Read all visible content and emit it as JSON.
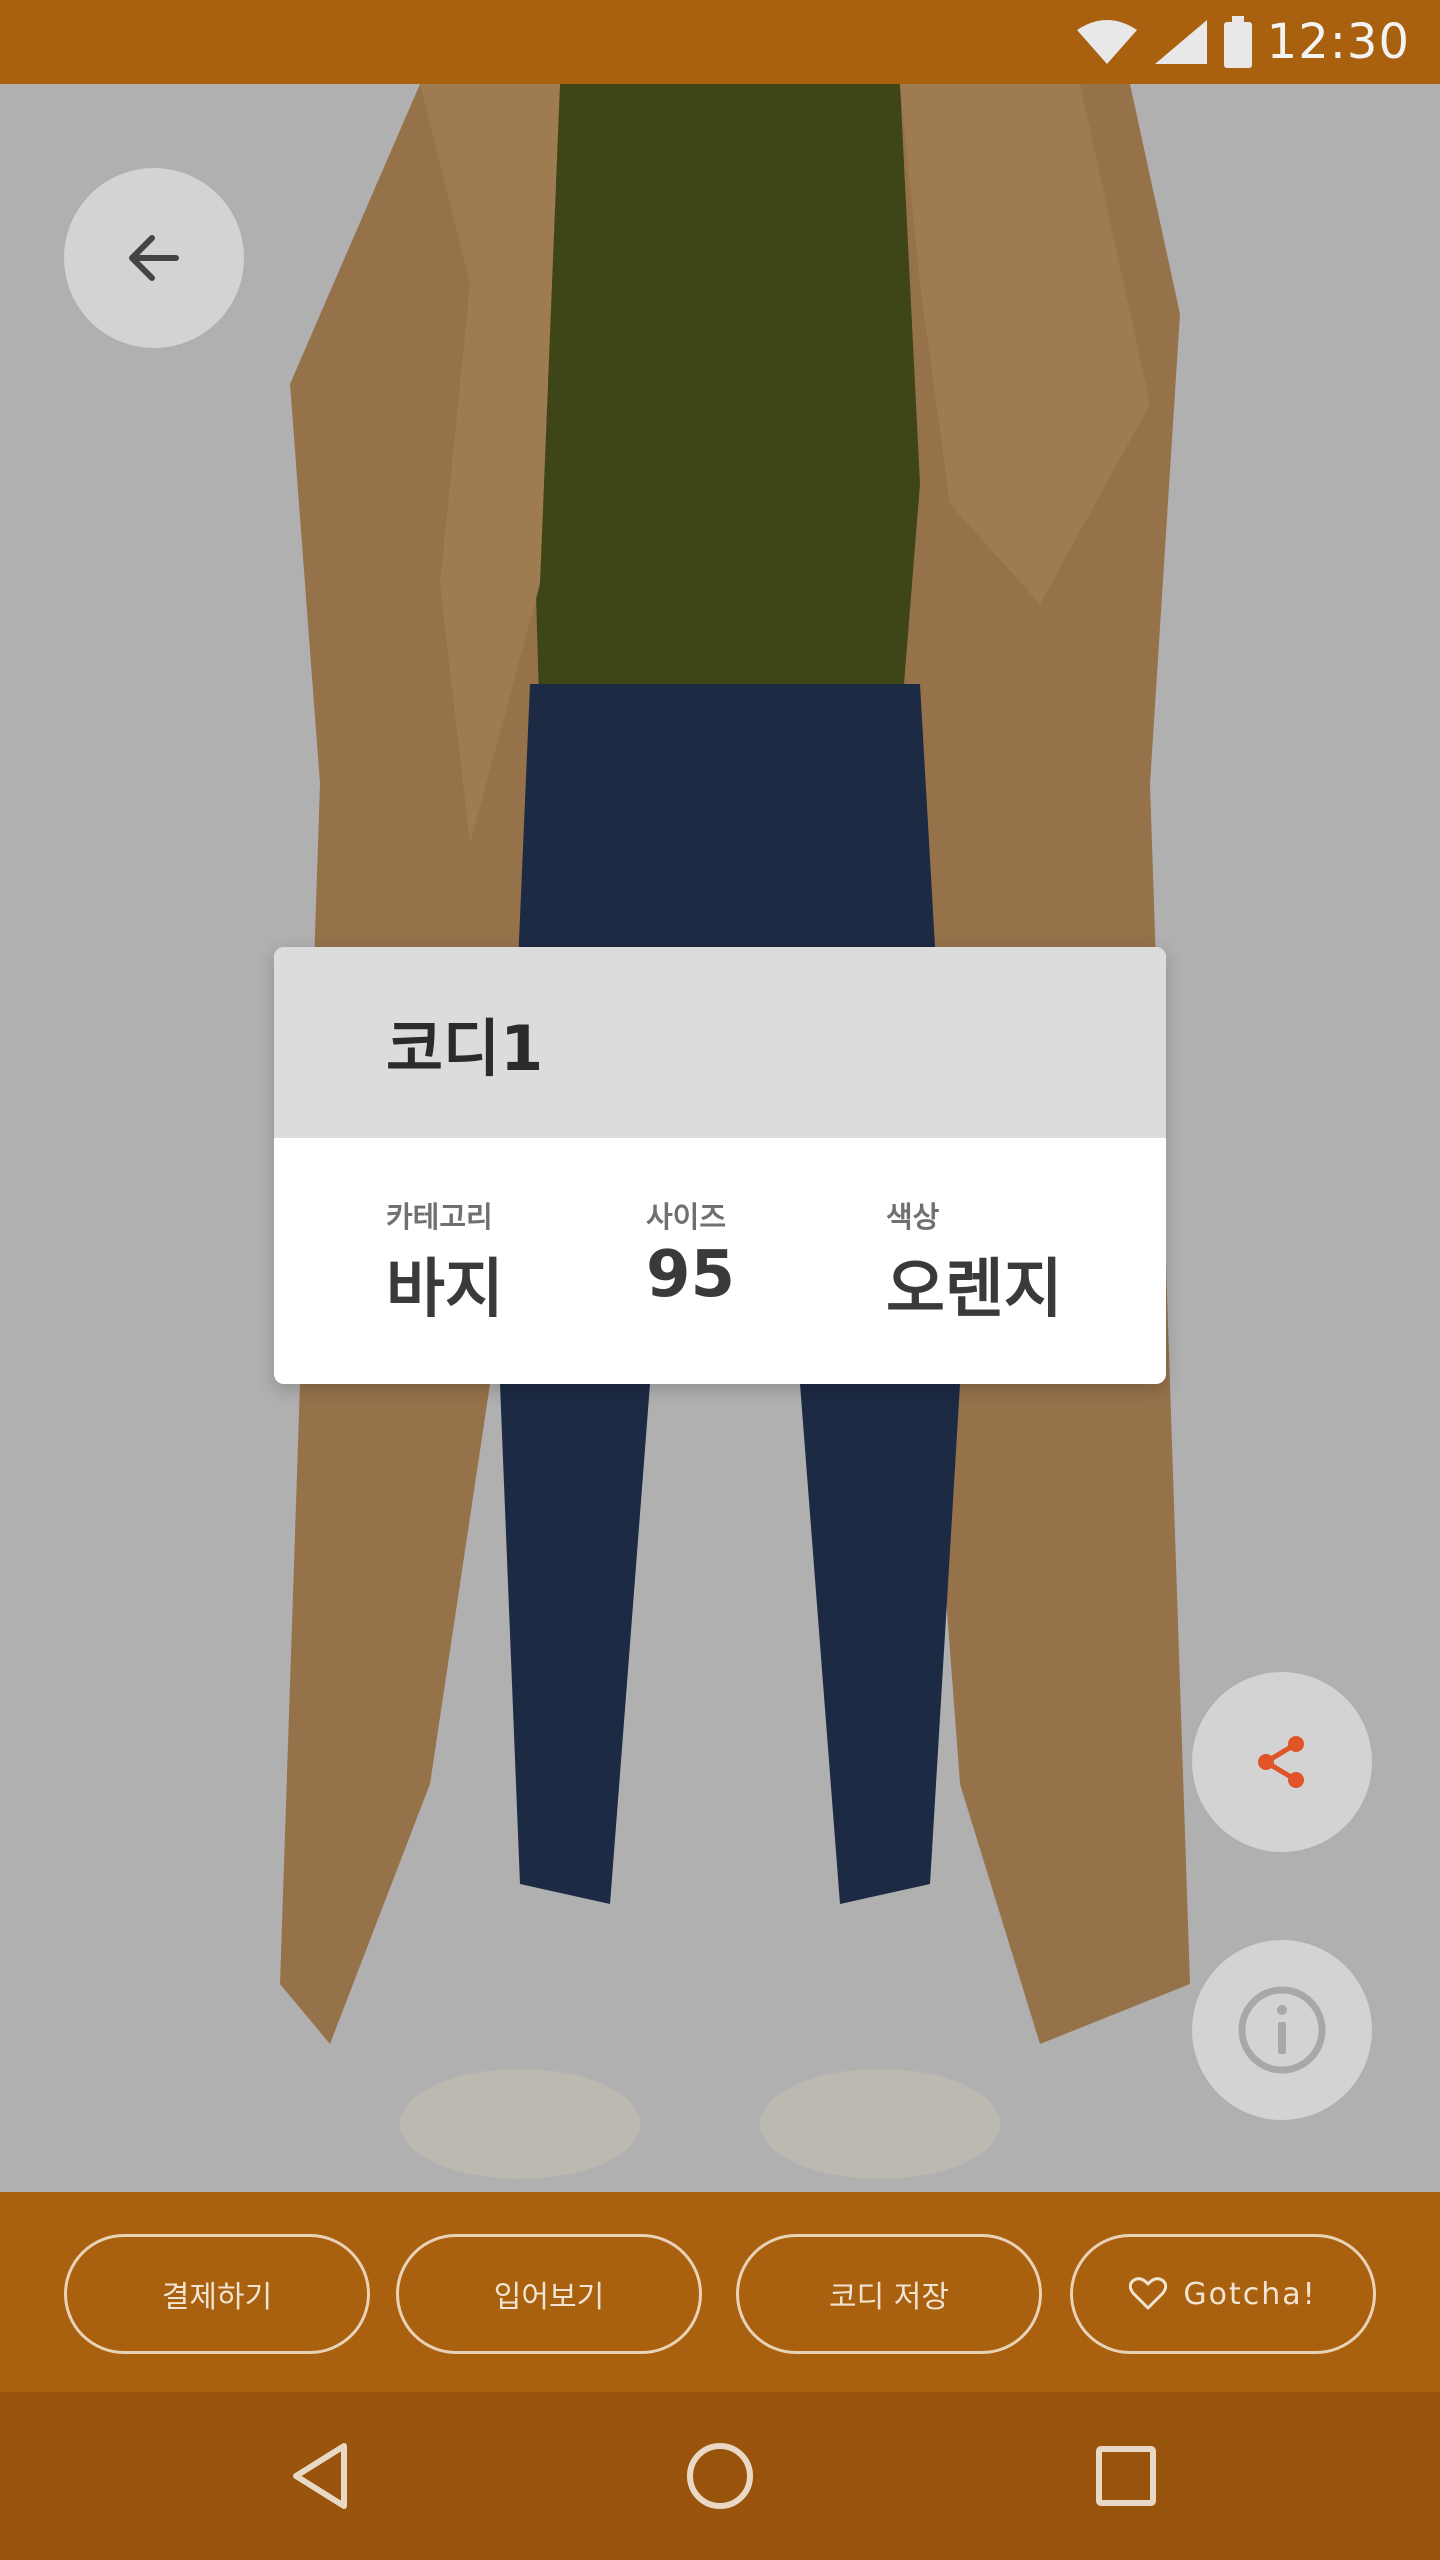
{
  "status_bar": {
    "time": "12:30",
    "icons": [
      "wifi-icon",
      "signal-icon",
      "battery-icon"
    ]
  },
  "photo": {
    "description_icon": "outfit-photo"
  },
  "buttons": {
    "back_icon": "arrow-left-icon",
    "share_icon": "share-icon",
    "info_icon": "info-icon"
  },
  "card": {
    "title": "코디1",
    "attributes": [
      {
        "label": "카테고리",
        "value": "바지"
      },
      {
        "label": "사이즈",
        "value": "95"
      },
      {
        "label": "색상",
        "value": "오렌지"
      }
    ]
  },
  "actions": [
    {
      "label": "결제하기"
    },
    {
      "label": "입어보기"
    },
    {
      "label": "코디 저장"
    },
    {
      "label": "Gotcha!",
      "icon": "heart-icon"
    }
  ],
  "nav": {
    "icons": [
      "nav-back-icon",
      "nav-home-icon",
      "nav-recents-icon"
    ]
  },
  "colors": {
    "primary": "#a9600f",
    "nav": "#98540d",
    "accent": "#e0542a"
  }
}
